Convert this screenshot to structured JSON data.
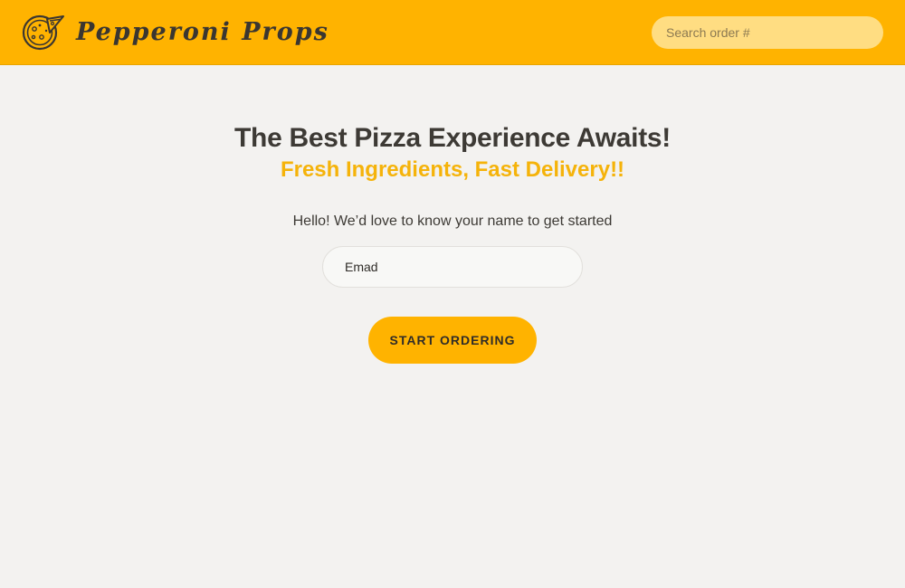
{
  "header": {
    "logo_icon": "pizza-icon",
    "brand_name": "Pepperoni Props",
    "search_placeholder": "Search order #"
  },
  "main": {
    "headline": "The Best Pizza Experience Awaits!",
    "subheadline": "Fresh Ingredients, Fast Delivery!!",
    "prompt": "Hello! We’d love to know your name to get started",
    "name_value": "Emad",
    "start_button_label": "START ORDERING"
  },
  "colors": {
    "brand_yellow": "#ffb300",
    "accent_text": "#f5b30a",
    "background": "#f3f2f0",
    "text_dark": "#3d3a35"
  }
}
